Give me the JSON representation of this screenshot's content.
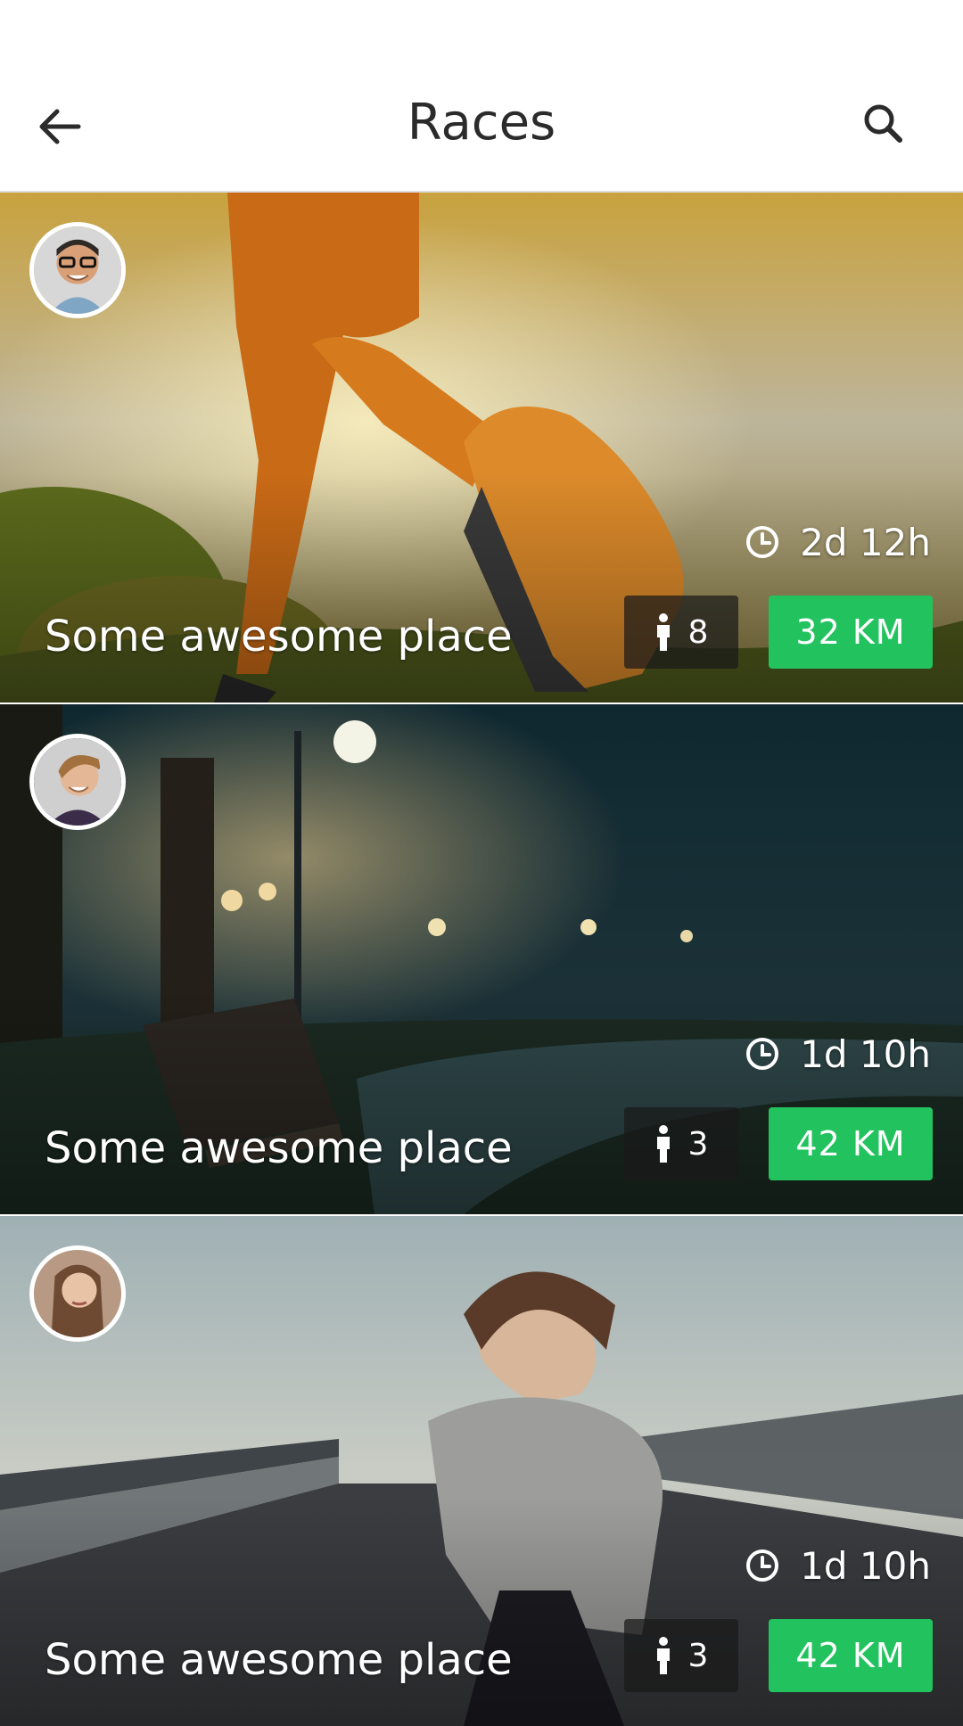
{
  "header": {
    "title": "Races"
  },
  "races": [
    {
      "place": "Some awesome place",
      "time_left": "2d 12h",
      "runners": "8",
      "distance": "32 KM"
    },
    {
      "place": "Some awesome place",
      "time_left": "1d 10h",
      "runners": "3",
      "distance": "42 KM"
    },
    {
      "place": "Some awesome place",
      "time_left": "1d 10h",
      "runners": "3",
      "distance": "42 KM"
    }
  ],
  "icons": {
    "back": "arrow-left-icon",
    "search": "search-icon",
    "timer": "clock-icon",
    "runners": "person-icon"
  },
  "colors": {
    "distance_badge": "#22c35e",
    "header_bg": "#ffffff",
    "title": "#2b2b2b"
  }
}
